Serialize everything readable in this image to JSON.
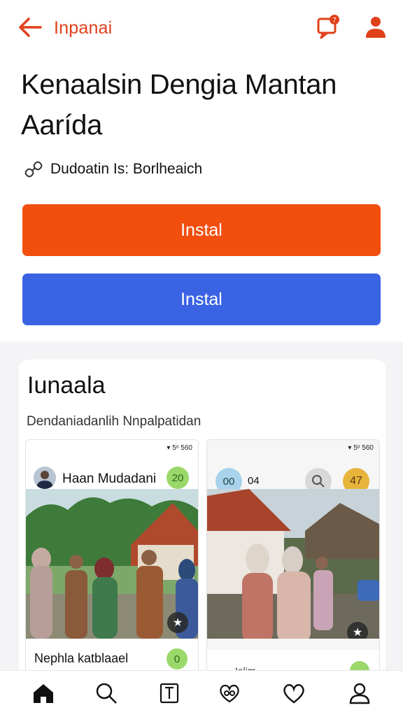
{
  "header": {
    "app_name": "Inpanai",
    "notification_count": "7"
  },
  "app": {
    "title": "Kenaalsin Dengia Mantan Aarída",
    "developer": "Dudoatin Is: Borlheaich"
  },
  "buttons": {
    "install_primary": "Instal",
    "install_secondary": "Instal"
  },
  "preview": {
    "heading": "Iunaala",
    "subheading": "Dendaniadanlih Nnpalpatidan",
    "screenshot_1": {
      "status": "▾ 5ᵒ 560",
      "user_name": "Haan Mudadani",
      "badge": "20",
      "caption": "Nephla katblaael",
      "caption_badge": "0"
    },
    "screenshot_2": {
      "status": "▾ 5ᵒ 560",
      "left_badge": "00",
      "count": "04",
      "right_badge": "47",
      "footer_text": "Ialim"
    }
  },
  "nav": {
    "items": [
      "home-icon",
      "search-icon",
      "library-icon",
      "community-icon",
      "heart-icon",
      "profile-icon"
    ]
  },
  "colors": {
    "accent": "#f24e0d",
    "blue": "#3a63e4",
    "header_red": "#e0401a"
  }
}
